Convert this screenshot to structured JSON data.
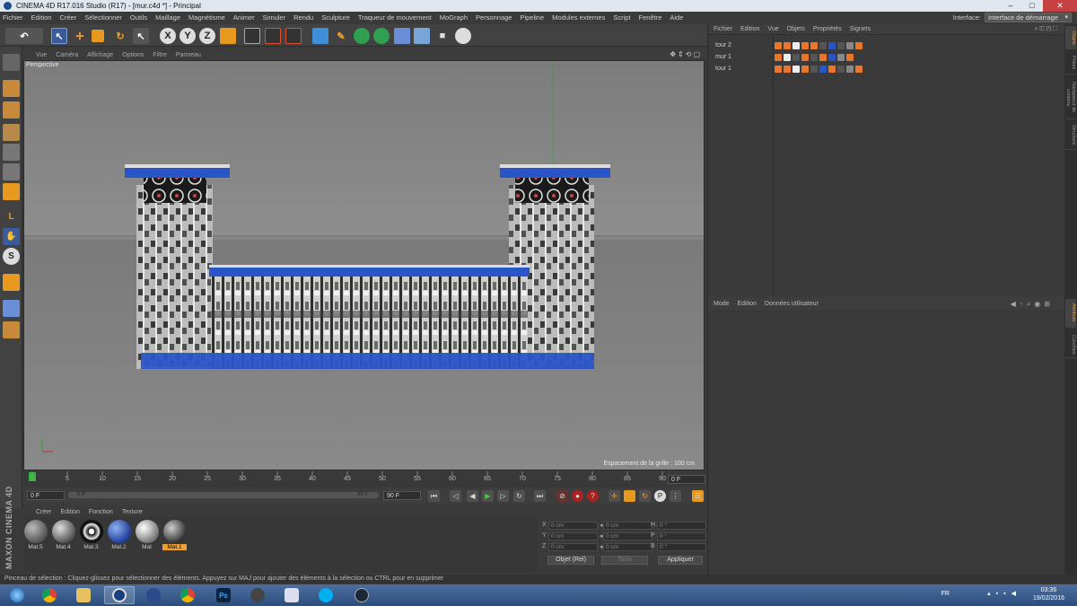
{
  "window": {
    "title": "CINEMA 4D R17.016 Studio (R17) - [mur.c4d *] - Principal"
  },
  "menubar": {
    "items": [
      "Fichier",
      "Edition",
      "Créer",
      "Sélectionner",
      "Outils",
      "Maillage",
      "Magnétisme",
      "Animer",
      "Simuler",
      "Rendu",
      "Sculpture",
      "Traqueur de mouvement",
      "MoGraph",
      "Personnage",
      "Pipeline",
      "Modules externes",
      "Script",
      "Fenêtre",
      "Aide"
    ],
    "interface_label": "Interface:",
    "interface_value": "Interface de démarrage"
  },
  "toolbar": {
    "icons": [
      "undo-icon",
      "live-selection-icon",
      "move-icon",
      "scale-icon",
      "rotate-icon",
      "cursor-icon",
      "x-axis-icon",
      "y-axis-icon",
      "z-axis-icon",
      "coordinate-system-icon",
      "render-view-icon",
      "render-settings-icon",
      "render-picture-icon",
      "cube-icon",
      "pen-icon",
      "subdivision-icon",
      "array-icon",
      "deformer-icon",
      "floor-icon",
      "camera-icon",
      "light-icon"
    ],
    "axis_x": "X",
    "axis_y": "Y",
    "axis_z": "Z"
  },
  "viewport": {
    "menu": [
      "Vue",
      "Caméra",
      "Affichage",
      "Options",
      "Filtre",
      "Panneau"
    ],
    "label": "Perspective",
    "grid_spacing": "Espacement de la grille : 100 cm"
  },
  "timeline": {
    "ticks": [
      "0",
      "5",
      "10",
      "15",
      "20",
      "25",
      "30",
      "35",
      "40",
      "45",
      "50",
      "55",
      "60",
      "65",
      "70",
      "75",
      "80",
      "85",
      "90"
    ],
    "current_frame": "0 F",
    "start_frame": "0 F",
    "end_frame": "90 F",
    "range_start": "0 F",
    "range_end": "90 F"
  },
  "materials": {
    "menu": [
      "Créer",
      "Edition",
      "Fonction",
      "Texture"
    ],
    "items": [
      {
        "label": "Mat.5",
        "color": "#8a8a8a"
      },
      {
        "label": "Mat.4",
        "color": "#9a9a9a"
      },
      {
        "label": "Mat.3",
        "color": "#222222"
      },
      {
        "label": "Mat.2",
        "color": "#2f5fb8"
      },
      {
        "label": "Mat",
        "color": "#c8c8c8"
      },
      {
        "label": "Mat.1",
        "color": "#6f6f6f"
      }
    ],
    "selected": "Mat.1"
  },
  "coords": {
    "rows": [
      {
        "axis": "X",
        "pos": "0 cm",
        "size": "0 cm",
        "rot_label": "H",
        "rot": "0 °"
      },
      {
        "axis": "Y",
        "pos": "0 cm",
        "size": "0 cm",
        "rot_label": "P",
        "rot": "0 °"
      },
      {
        "axis": "Z",
        "pos": "0 cm",
        "size": "0 cm",
        "rot_label": "B",
        "rot": "0 °"
      }
    ],
    "mode": "Objet (Rel)",
    "size_mode": "Taille",
    "apply": "Appliquer"
  },
  "objects": {
    "menu": [
      "Fichier",
      "Edition",
      "Vue",
      "Objets",
      "Propriétés",
      "Signets"
    ],
    "items": [
      "tour 2",
      "mur 1",
      "tour 1"
    ]
  },
  "attributes": {
    "menu": [
      "Mode",
      "Edition",
      "Données utilisateur"
    ]
  },
  "righttabs": [
    "Objets",
    "Prises",
    "Navigateur de contenu",
    "Structure",
    "Attributs",
    "Couches"
  ],
  "status": "Pinceau de sélection : Cliquez-glissez pour sélectionner des éléments. Appuyez sur MAJ pour ajouter des éléments à la sélection ou CTRL pour en supprimer",
  "taskbar": {
    "apps": [
      "start-icon",
      "chrome-icon",
      "explorer-icon",
      "cinema4d-icon",
      "blender-icon",
      "chrome-icon",
      "photoshop-icon",
      "settings-icon",
      "network-icon",
      "skype-icon",
      "steam-icon"
    ],
    "lang": "FR",
    "time": "03:36",
    "date": "19/02/2016"
  }
}
